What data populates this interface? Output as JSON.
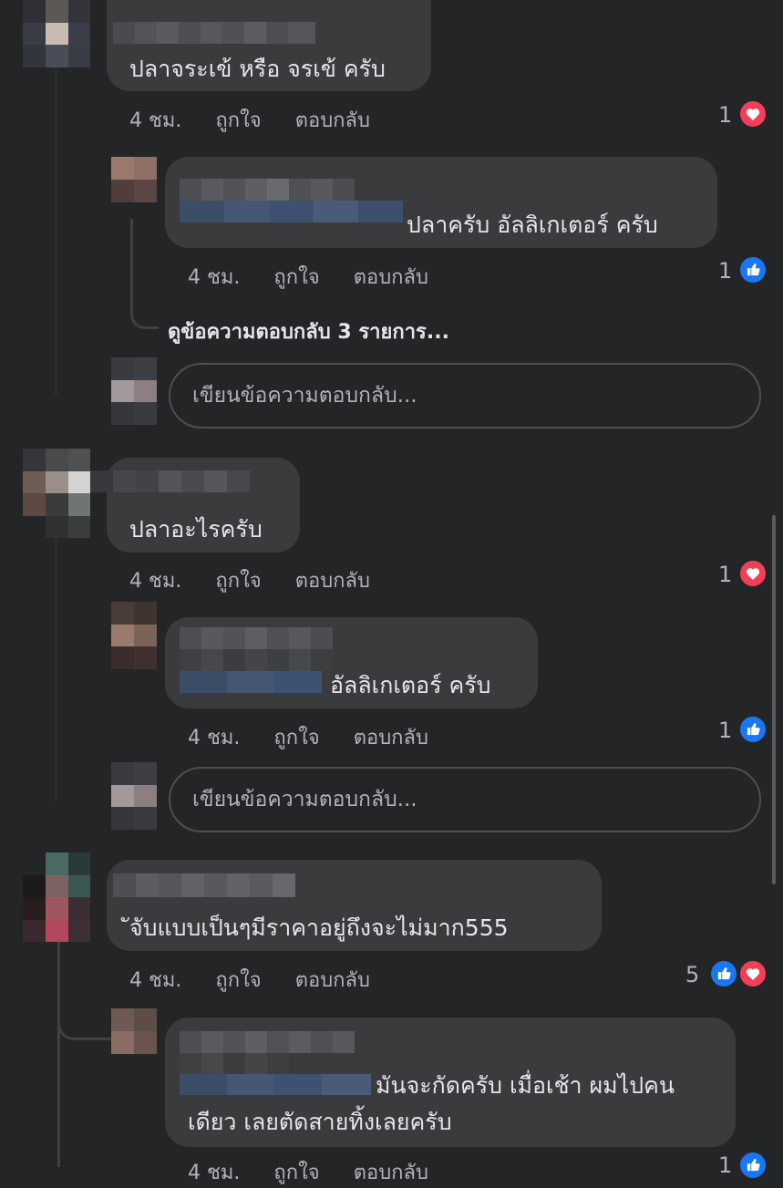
{
  "labels": {
    "time": "4 ชม.",
    "like": "ถูกใจ",
    "reply": "ตอบกลับ",
    "reply_placeholder": "เขียนข้อความตอบกลับ...",
    "view_more": "ดูข้อความตอบกลับ 3 รายการ..."
  },
  "comments": [
    {
      "text": "ปลาจระเข้ หรือ จรเข้ ครับ",
      "reaction_count": "1",
      "reactions": [
        "heart-icon"
      ],
      "replies": [
        {
          "text": "ปลาครับ อัลลิเกเตอร์ ครับ",
          "reaction_count": "1",
          "reactions": [
            "like-icon"
          ]
        }
      ]
    },
    {
      "text": "ปลาอะไรครับ",
      "reaction_count": "1",
      "reactions": [
        "heart-icon"
      ],
      "replies": [
        {
          "text": "อัลลิเกเตอร์ ครับ",
          "reaction_count": "1",
          "reactions": [
            "like-icon"
          ]
        }
      ]
    },
    {
      "text": "ัจับแบบเป็นๆมีราคาอยู่ถึงจะไม่มาก555",
      "reaction_count": "5",
      "reactions": [
        "like-icon",
        "heart-icon"
      ],
      "replies": [
        {
          "text_line1": "มันจะกัดครับ เมื่อเช้า ผมไปคน",
          "text_line2": "เดียว เลยตัดสายทิ้งเลยครับ",
          "reaction_count": "1",
          "reactions": [
            "like-icon"
          ]
        }
      ]
    }
  ],
  "colors": {
    "background": "#242526",
    "bubble": "#3a3b3c",
    "like_blue": "#1877f2",
    "heart_red": "#f33e58",
    "meta_text": "#b0b3b8"
  }
}
